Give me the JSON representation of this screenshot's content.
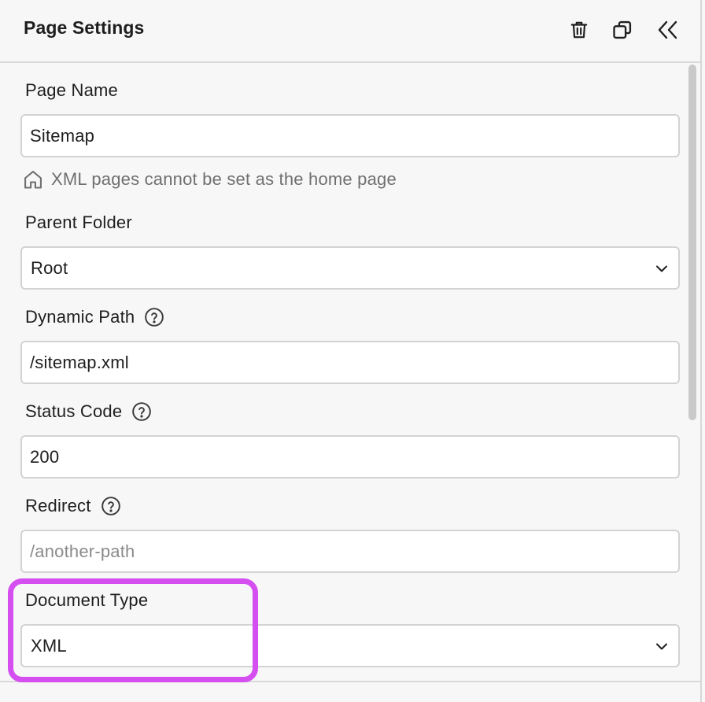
{
  "panel": {
    "title": "Page Settings",
    "actions": [
      {
        "name": "trash-icon"
      },
      {
        "name": "duplicate-icon"
      },
      {
        "name": "collapse-icon"
      }
    ]
  },
  "fields": {
    "page_name": {
      "label": "Page Name",
      "value": "Sitemap",
      "hint": "XML pages cannot be set as the home page",
      "hint_icon": "home-icon"
    },
    "parent_folder": {
      "label": "Parent Folder",
      "value": "Root"
    },
    "dynamic_path": {
      "label": "Dynamic Path",
      "value": "/sitemap.xml",
      "help_icon": "help-icon"
    },
    "status_code": {
      "label": "Status Code",
      "value": "200",
      "help_icon": "help-icon"
    },
    "redirect": {
      "label": "Redirect",
      "value": "",
      "placeholder": "/another-path",
      "help_icon": "help-icon"
    },
    "document_type": {
      "label": "Document Type",
      "value": "XML"
    }
  },
  "colors": {
    "background": "#f7f7f7",
    "field_border": "#d3d3d3",
    "highlight": "#d44ef0",
    "hint_text": "#6f6f6f"
  }
}
